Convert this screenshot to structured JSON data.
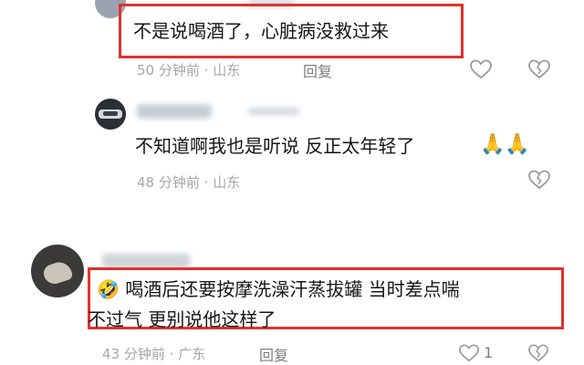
{
  "comments": [
    {
      "text": "不是说喝酒了，心脏病没救过来",
      "time": "50 分钟前",
      "location": "山东",
      "reply_label": "回复"
    },
    {
      "text": "不知道啊我也是听说 反正太年轻了",
      "emoji": "🙏🙏",
      "time": "48 分钟前",
      "location": "山东"
    },
    {
      "emoji": "🤣",
      "text_line1": "喝酒后还要按摩洗澡汗蒸拔罐 当时差点喘",
      "text_line2": "不过气 更别说他这样了",
      "time": "43 分钟前",
      "location": "广东",
      "reply_label": "回复",
      "like_count": "1"
    }
  ],
  "separator": "·",
  "colors": {
    "highlight_border": "#e0322e",
    "meta_text": "#a6a6a6",
    "body_text": "#161616"
  }
}
